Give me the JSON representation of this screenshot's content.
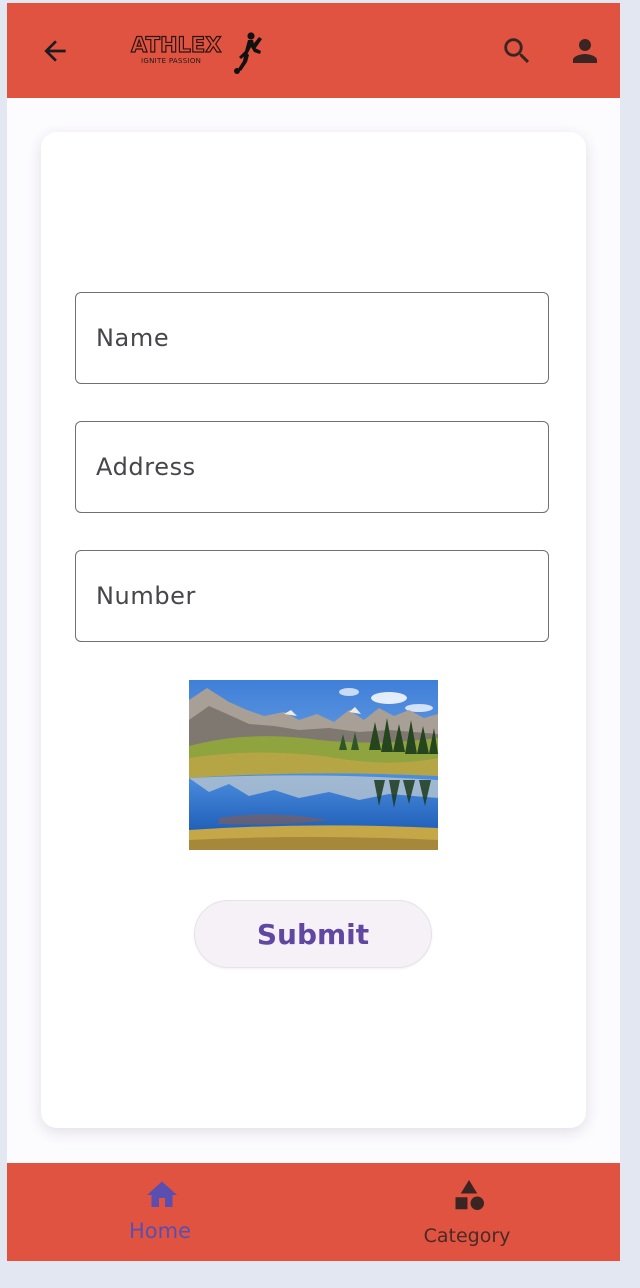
{
  "appbar": {
    "logo_text": "ATHLEX",
    "logo_tagline": "IGNITE PASSION",
    "back_icon": "arrow-left-icon",
    "search_icon": "search-icon",
    "profile_icon": "person-icon"
  },
  "form": {
    "name_placeholder": "Name",
    "address_placeholder": "Address",
    "number_placeholder": "Number",
    "image": "mountain-lake-landscape",
    "submit_label": "Submit"
  },
  "bottom_nav": {
    "items": [
      {
        "label": "Home",
        "icon": "home-icon",
        "selected": true
      },
      {
        "label": "Category",
        "icon": "category-shapes-icon",
        "selected": false
      }
    ]
  },
  "colors": {
    "primary": "#e05340",
    "accent": "#5a4fb0",
    "submit_text": "#6047a2",
    "background": "#fcfbfe",
    "outer": "#e3e7f1"
  }
}
